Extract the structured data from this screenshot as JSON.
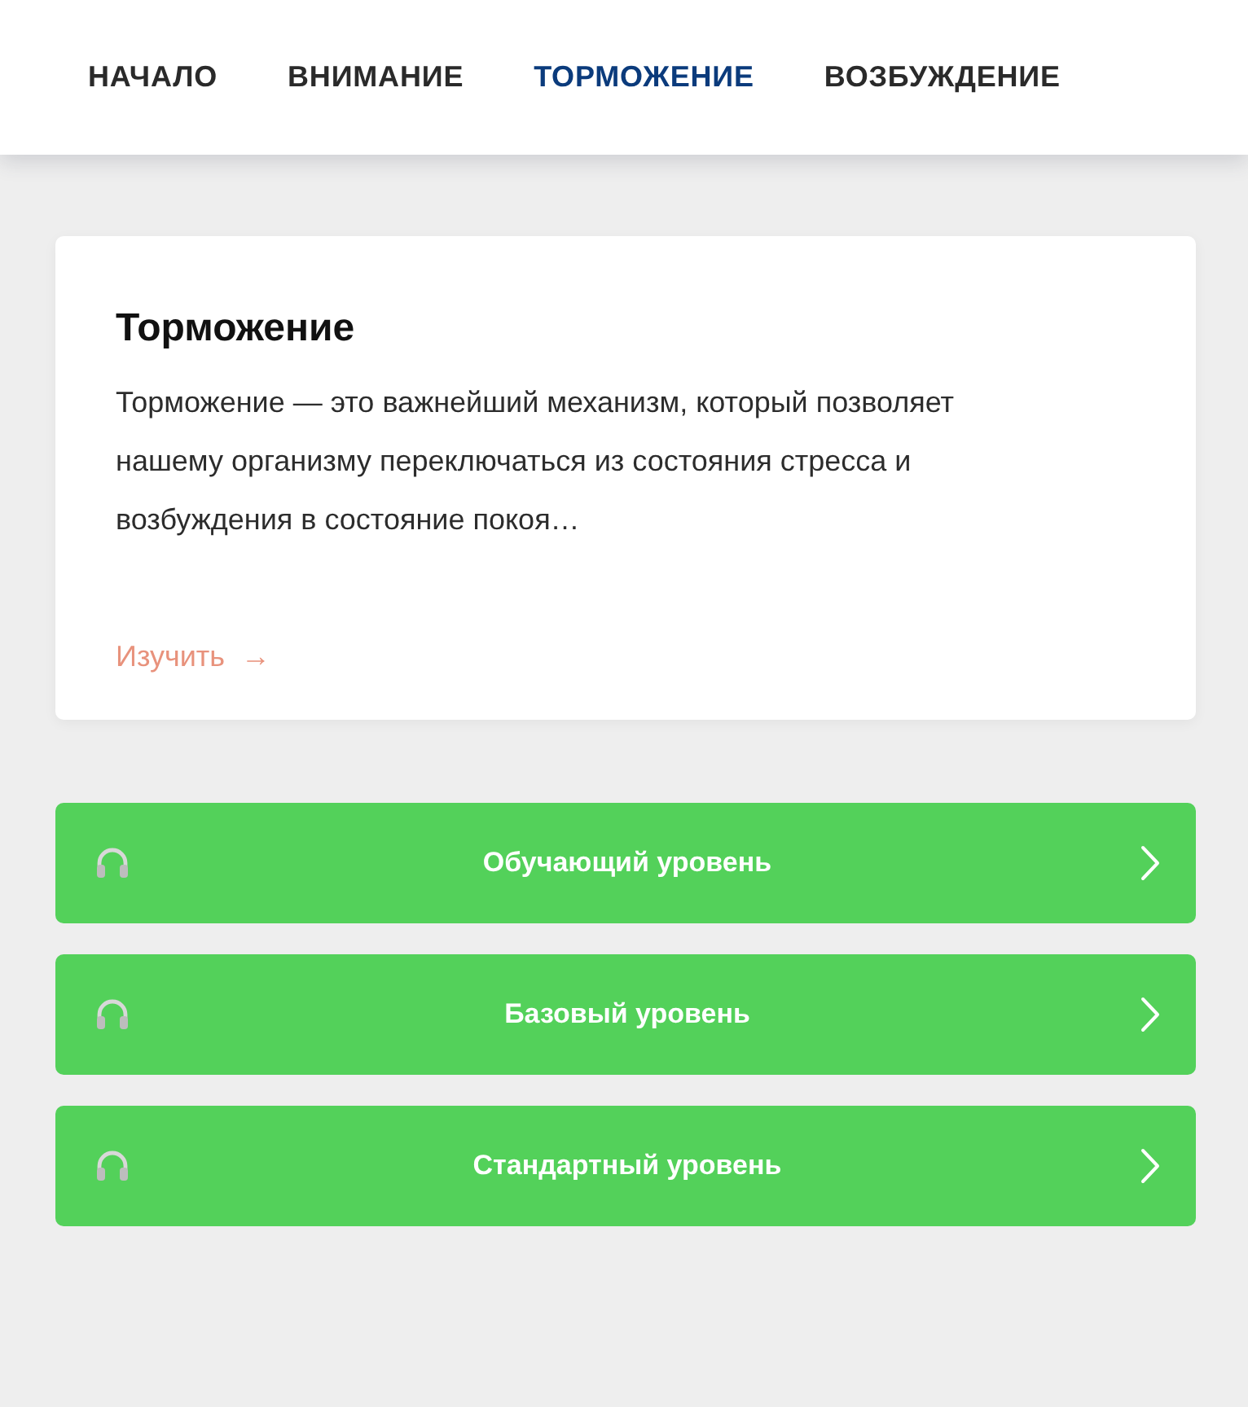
{
  "nav": {
    "tabs": [
      {
        "label": "НАЧАЛО",
        "selected": false
      },
      {
        "label": "ВНИМАНИЕ",
        "selected": false
      },
      {
        "label": "ТОРМОЖЕНИЕ",
        "selected": true
      },
      {
        "label": "ВОЗБУЖДЕНИЕ",
        "selected": false
      }
    ]
  },
  "card": {
    "title": "Торможение",
    "text": "Торможение — это важнейший механизм, который позволяет нашему организму переключаться из состояния стресса и возбуждения в состояние покоя…",
    "link": {
      "label": "Изучить",
      "arrow": "→"
    }
  },
  "levels": [
    {
      "label": "Обучающий уровень"
    },
    {
      "label": "Базовый уровень"
    },
    {
      "label": "Стандартный уровень"
    }
  ]
}
